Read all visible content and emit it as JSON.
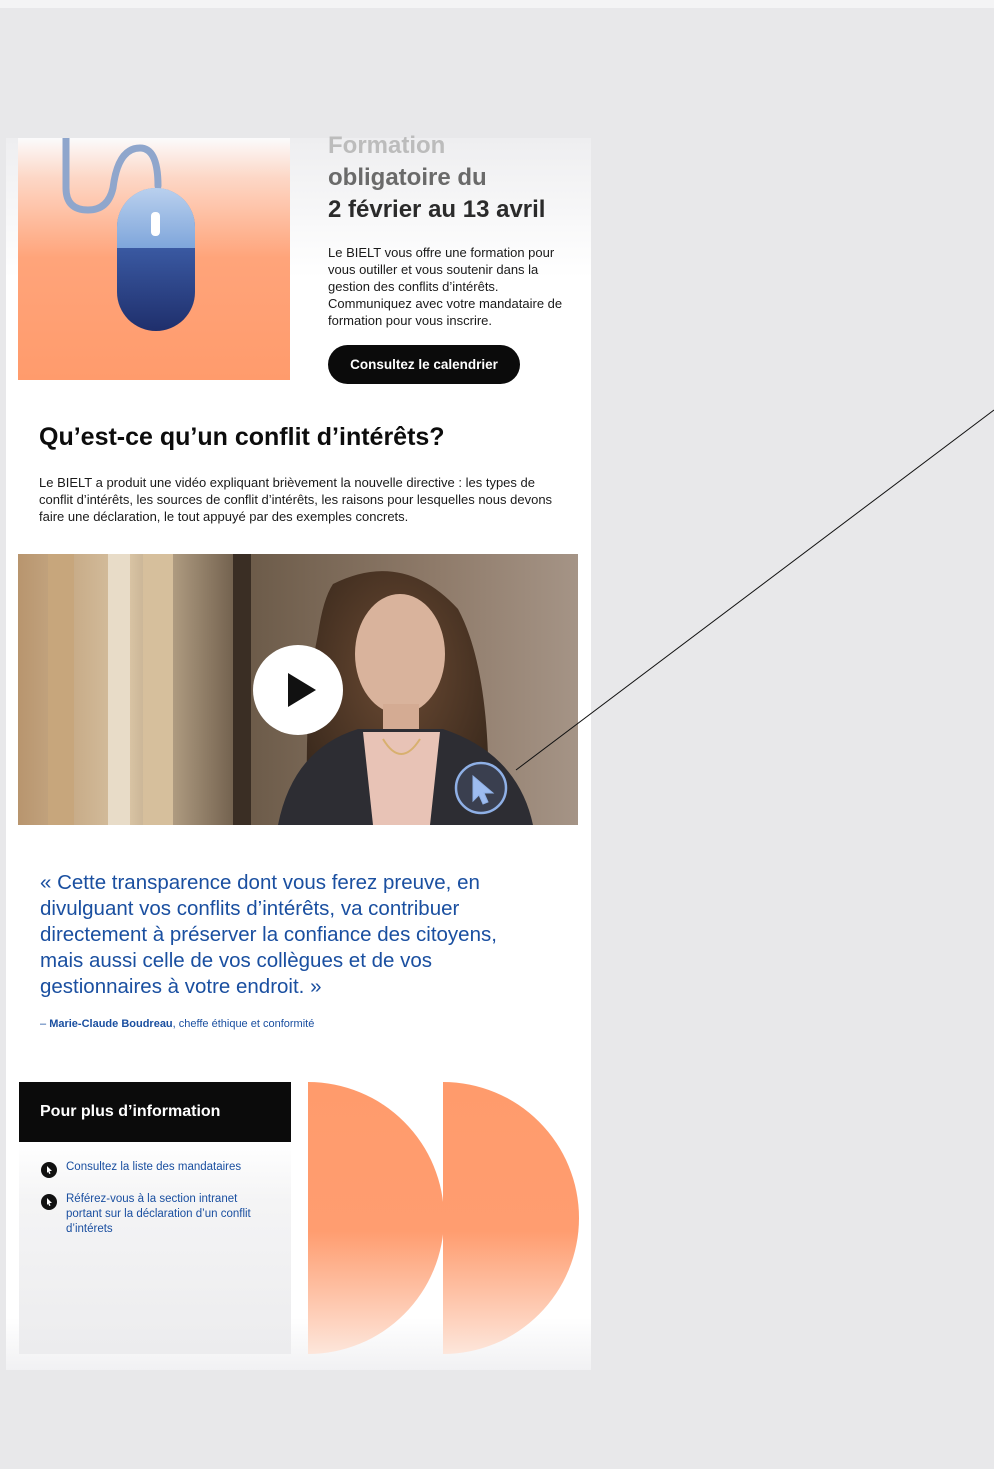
{
  "hero": {
    "title_line1": "Formation",
    "title_line2": "obligatoire du",
    "title_line3": "2 février au 13 avril",
    "text": "Le BIELT vous offre une formation pour vous outiller et vous soutenir dans la gestion des conflits d’intérêts. Communiquez avec votre mandataire de formation pour vous inscrire.",
    "button_label": "Consultez le calendrier"
  },
  "section": {
    "title": "Qu’est-ce qu’un conflit d’intérêts?",
    "text": "Le BIELT a produit une vidéo expliquant brièvement la nouvelle directive : les types de conflit d’intérêts, les sources de conflit d’intérêts, les raisons pour lesquelles nous devons faire une déclaration, le tout appuyé par des exemples concrets."
  },
  "quote": {
    "text": "« Cette transparence dont vous ferez preuve, en divulguant vos conflits d’intérêts, va contribuer directement à préserver la confiance des citoyens, mais aussi celle de vos collègues et de vos gestionnaires à votre endroit.  »",
    "author_prefix": "– ",
    "author_name": "Marie-Claude Boudreau",
    "author_role": ", cheffe éthique et conformité"
  },
  "info": {
    "title": "Pour plus d’information",
    "links": [
      "Consultez la liste des mandataires",
      "Référez-vous à la section intranet portant sur la déclaration d’un conflit d’intérets"
    ]
  },
  "colors": {
    "accent_orange": "#ff9b6c",
    "link_blue": "#1a4fa0",
    "mouse_blue": "#233a78"
  },
  "icons": {
    "hero": "computer-mouse-icon",
    "video_play": "play-icon",
    "video_cursor": "cursor-arrow-icon",
    "info_bullet": "cursor-bullet-icon"
  }
}
